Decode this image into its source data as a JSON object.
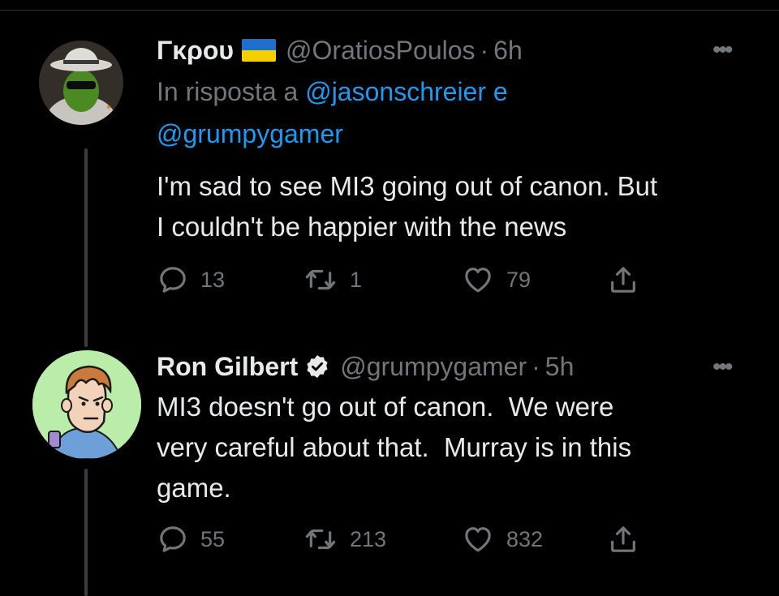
{
  "tweet1": {
    "display_name": "Γκρου",
    "handle": "@OratiosPoulos",
    "separator": "·",
    "time": "6h",
    "reply_prefix": "In risposta a",
    "reply_user1": "@jasonschreier",
    "reply_conj": "e",
    "reply_user2": "@grumpygamer",
    "text_line1": "I'm sad to see MI3 going out of canon. But",
    "text_line2": "I couldn't be happier with the news",
    "stats": {
      "replies": "13",
      "retweets": "1",
      "likes": "79"
    },
    "flag_colors": {
      "top": "#1f6fd1",
      "bottom": "#f5d000"
    }
  },
  "tweet2": {
    "display_name": "Ron Gilbert",
    "handle": "@grumpygamer",
    "separator": "·",
    "time": "5h",
    "text_line1": "MI3 doesn't go out of canon.  We were",
    "text_line2": "very careful about that.  Murray is in this",
    "text_line3": "game.",
    "stats": {
      "replies": "55",
      "retweets": "213",
      "likes": "832"
    }
  },
  "colors": {
    "background": "#000000",
    "text": "#e7e9ea",
    "secondary": "#71767b",
    "link": "#1d9bf0",
    "thread_line": "#3a3d40"
  }
}
